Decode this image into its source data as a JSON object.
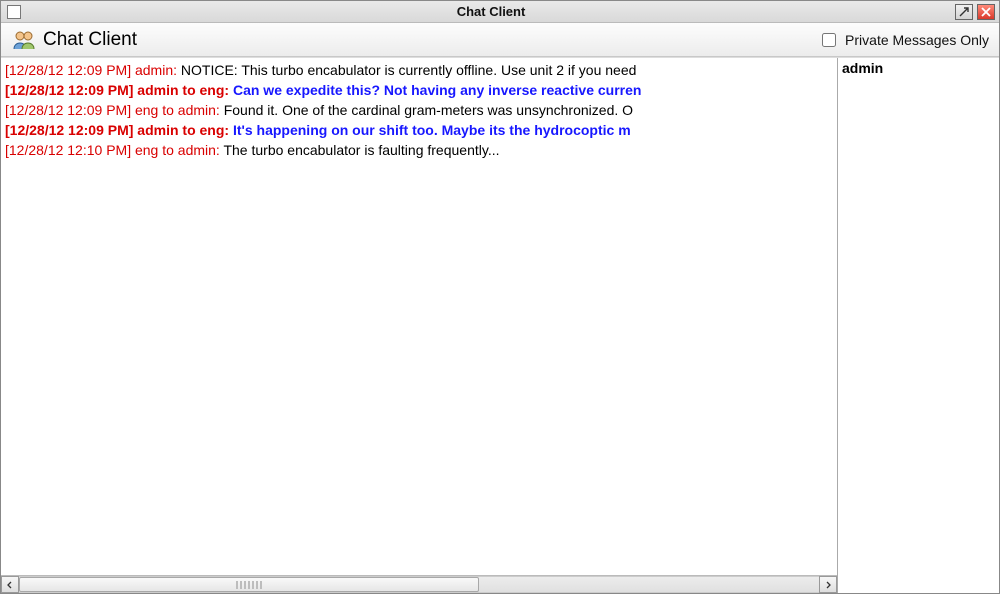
{
  "window": {
    "title": "Chat Client"
  },
  "panel": {
    "title": "Chat Client",
    "private_only_label": "Private Messages Only",
    "private_only_checked": false
  },
  "users": [
    "admin"
  ],
  "messages": [
    {
      "timestamp": "[12/28/12 12:09 PM]",
      "sender": "admin:",
      "text": "NOTICE: This turbo encabulator is currently offline. Use unit 2 if you need",
      "bold": false,
      "msgStyle": "black"
    },
    {
      "timestamp": "[12/28/12 12:09 PM]",
      "sender": "admin to eng:",
      "text": "Can we expedite this? Not having any inverse reactive curren",
      "bold": true,
      "msgStyle": "blue"
    },
    {
      "timestamp": "[12/28/12 12:09 PM]",
      "sender": "eng to admin:",
      "text": "Found it. One of the cardinal gram-meters was unsynchronized. O",
      "bold": false,
      "msgStyle": "black"
    },
    {
      "timestamp": "[12/28/12 12:09 PM]",
      "sender": "admin to eng:",
      "text": "It's happening on our shift too. Maybe its the hydrocoptic m",
      "bold": true,
      "msgStyle": "blue"
    },
    {
      "timestamp": "[12/28/12 12:10 PM]",
      "sender": "eng to admin:",
      "text": "The turbo encabulator is faulting frequently...",
      "bold": false,
      "msgStyle": "black"
    }
  ]
}
